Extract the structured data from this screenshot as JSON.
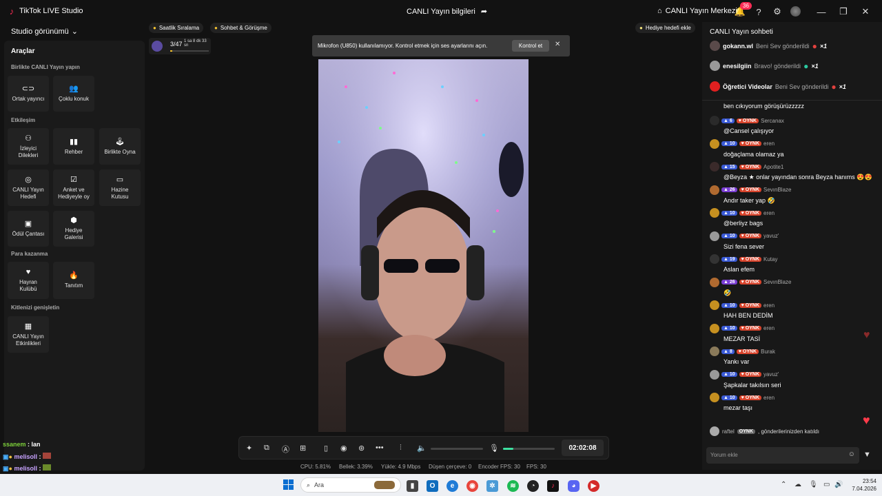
{
  "titlebar": {
    "app_title": "TikTok LIVE Studio",
    "live_info": "CANLI Yayın bilgileri",
    "center_label": "CANLI Yayın Merkezi",
    "notification_count": "36"
  },
  "left": {
    "studio_view": "Studio görünümü",
    "tools_title": "Araçlar",
    "sections": {
      "together": "Birlikte CANLI Yayın yapın",
      "interaction": "Etkileşim",
      "earn": "Para kazanma",
      "audience": "Kitlenizi genişletin"
    },
    "tools": {
      "cohost": "Ortak yayıncı",
      "multiguest": "Çoklu konuk",
      "viewer_wishes": "İzleyici Dilekleri",
      "guide": "Rehber",
      "play_together": "Birlikte Oyna",
      "live_goal": "CANLI Yayın Hedefi",
      "poll": "Anket ve Hediyeyle oy",
      "treasure": "Hazine Kutusu",
      "reward_bag": "Ödül Çantası",
      "gift_gallery": "Hediye Galerisi",
      "fan_club": "Hayran Kulübü",
      "promotion": "Tanıtım",
      "live_events": "CANLI Yayın Etkinlikleri"
    }
  },
  "center": {
    "pill_hourly": "Saatlik Sıralama",
    "pill_chat": "Sohbet & Görüşme",
    "progress_value": "3/47",
    "progress_time": "1 sa 8 dk 33 sn",
    "progress_fraction": 0.06,
    "notice_text": "Mikrofon (U850) kullanılamıyor. Kontrol etmek için ses ayarlarını açın.",
    "notice_button": "Kontrol et",
    "gift_goal": "Hediye hedefi ekle",
    "timer": "02:02:08",
    "mic_level": 0.2,
    "stats": {
      "cpu": "CPU:  5.81%",
      "memory": "Bellek:  3.39%",
      "upload": "Yükle:  4.9 Mbps",
      "dropped": "Düşen çerçeve:  0",
      "encoder_fps": "Encoder FPS:  30",
      "fps": "FPS:  30"
    }
  },
  "overlay_chat": [
    {
      "name": "ssanem",
      "text": ": lan",
      "color": "#7dd13a"
    },
    {
      "name": "melisoll",
      "text": ":",
      "color": "#c8a3ff"
    },
    {
      "name": "melisoll",
      "text": ":",
      "color": "#c8a3ff"
    }
  ],
  "chat": {
    "title": "CANLI Yayın sohbeti",
    "gifts": [
      {
        "user": "gokann.wl",
        "text": "Beni Sev gönderildi",
        "count": "×1"
      },
      {
        "user": "enesilgiin",
        "text": "Bravo! gönderildi",
        "count": "×1"
      },
      {
        "user": "Öğretici Videolar",
        "text": "Beni Sev gönderildi",
        "count": "×1"
      }
    ],
    "messages": [
      {
        "level": "",
        "user": "",
        "text": "ben cıkıyorum görüşürüzzzzz"
      },
      {
        "level": "6",
        "user": "Sercanax",
        "text": "@Cansel çalışıyor"
      },
      {
        "level": "10",
        "user": "eren",
        "text": "doğaçlama olamaz ya"
      },
      {
        "level": "15",
        "user": "Apotite1",
        "text": "@Beyza ★ onlar yayından sonra Beyza hanıms 😍😍"
      },
      {
        "level": "26",
        "user": "SevınBlaze",
        "text": "Andır taker yap 🤣"
      },
      {
        "level": "10",
        "user": "eren",
        "text": "@berliyz bags"
      },
      {
        "level": "10",
        "user": "yavuz'",
        "text": "Sizi fena sever"
      },
      {
        "level": "19",
        "user": "Kutay",
        "text": "Aslan efem"
      },
      {
        "level": "26",
        "user": "SevınBlaze",
        "text": "🤣"
      },
      {
        "level": "10",
        "user": "eren",
        "text": "HAH BEN DEDİM"
      },
      {
        "level": "10",
        "user": "eren",
        "text": "MEZAR TASİ"
      },
      {
        "level": "8",
        "user": "Burak",
        "text": "Yankı var"
      },
      {
        "level": "10",
        "user": "yavuz'",
        "text": "Şapkalar takılsın seri"
      },
      {
        "level": "10",
        "user": "eren",
        "text": "mezar taşı"
      }
    ],
    "badge_label": "OYNK",
    "join_user": "raftel",
    "join_text": ", gönderilerinizden katıldı",
    "comment_placeholder": "Yorum ekle"
  },
  "taskbar": {
    "search": "Ara",
    "time": "23:54",
    "date": "7.04.2026"
  }
}
